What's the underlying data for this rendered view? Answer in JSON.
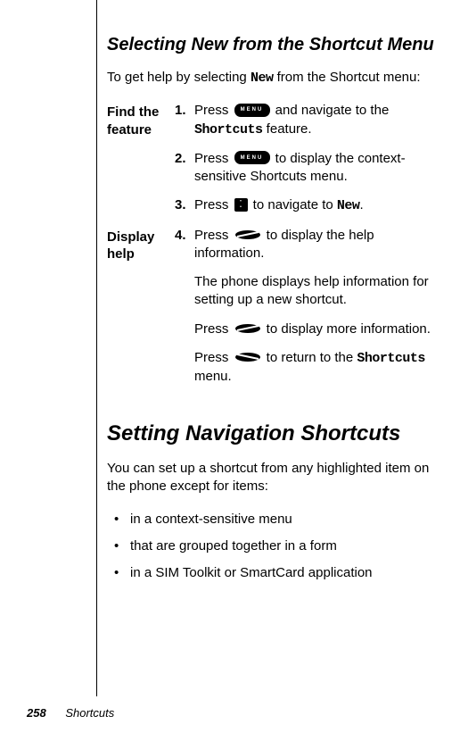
{
  "heading1": "Selecting New from the Shortcut Menu",
  "intro1_a": "To get help by selecting ",
  "intro1_mono": "New",
  "intro1_b": " from the Shortcut menu:",
  "find_label": "Find the feature",
  "display_label": "Display help",
  "step1_num": "1.",
  "step1_a": "Press ",
  "step1_b": " and navigate to the ",
  "step1_mono": "Shortcuts",
  "step1_c": " feature.",
  "step2_num": "2.",
  "step2_a": "Press ",
  "step2_b": " to display the context-sensitive Shortcuts menu.",
  "step3_num": "3.",
  "step3_a": "Press ",
  "step3_b": " to navigate to ",
  "step3_mono": "New",
  "step3_c": ".",
  "step4_num": "4.",
  "step4_a": "Press ",
  "step4_b": " to display the help information.",
  "step4_ex1": "The phone displays help information for setting up a new shortcut.",
  "step4_ex2a": "Press ",
  "step4_ex2b": " to display more information.",
  "step4_ex3a": "Press ",
  "step4_ex3b": " to return to the ",
  "step4_ex3_mono": "Shortcuts",
  "step4_ex3c": " menu.",
  "heading2": "Setting Navigation Shortcuts",
  "intro2": "You can set up a shortcut from any highlighted item on the phone except for items:",
  "bullet1": "in a context-sensitive menu",
  "bullet2": "that are grouped together in a form",
  "bullet3": "in a SIM Toolkit or SmartCard application",
  "page_number": "258",
  "footer_section": "Shortcuts",
  "menu_icon_label": "MENU"
}
